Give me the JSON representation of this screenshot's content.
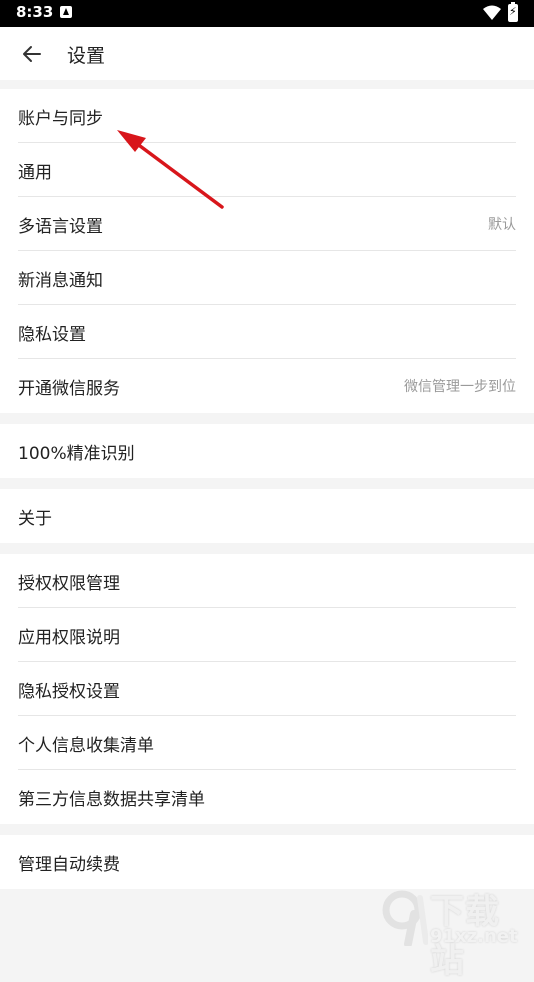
{
  "status_bar": {
    "time": "8:33"
  },
  "header": {
    "title": "设置"
  },
  "groups": [
    {
      "items": [
        {
          "label": "账户与同步",
          "value": ""
        },
        {
          "label": "通用",
          "value": ""
        },
        {
          "label": "多语言设置",
          "value": "默认"
        },
        {
          "label": "新消息通知",
          "value": ""
        },
        {
          "label": "隐私设置",
          "value": ""
        },
        {
          "label": "开通微信服务",
          "value": "微信管理一步到位"
        }
      ]
    },
    {
      "items": [
        {
          "label": "100%精准识别",
          "value": ""
        }
      ]
    },
    {
      "items": [
        {
          "label": "关于",
          "value": ""
        }
      ]
    },
    {
      "items": [
        {
          "label": "授权权限管理",
          "value": ""
        },
        {
          "label": "应用权限说明",
          "value": ""
        },
        {
          "label": "隐私授权设置",
          "value": ""
        },
        {
          "label": "个人信息收集清单",
          "value": ""
        },
        {
          "label": "第三方信息数据共享清单",
          "value": ""
        }
      ]
    },
    {
      "items": [
        {
          "label": "管理自动续费",
          "value": ""
        }
      ]
    }
  ],
  "watermark": {
    "top": "下载站",
    "bottom": "91xz.net"
  },
  "colors": {
    "annotation_arrow": "#d8161b",
    "background": "#f4f4f4"
  }
}
